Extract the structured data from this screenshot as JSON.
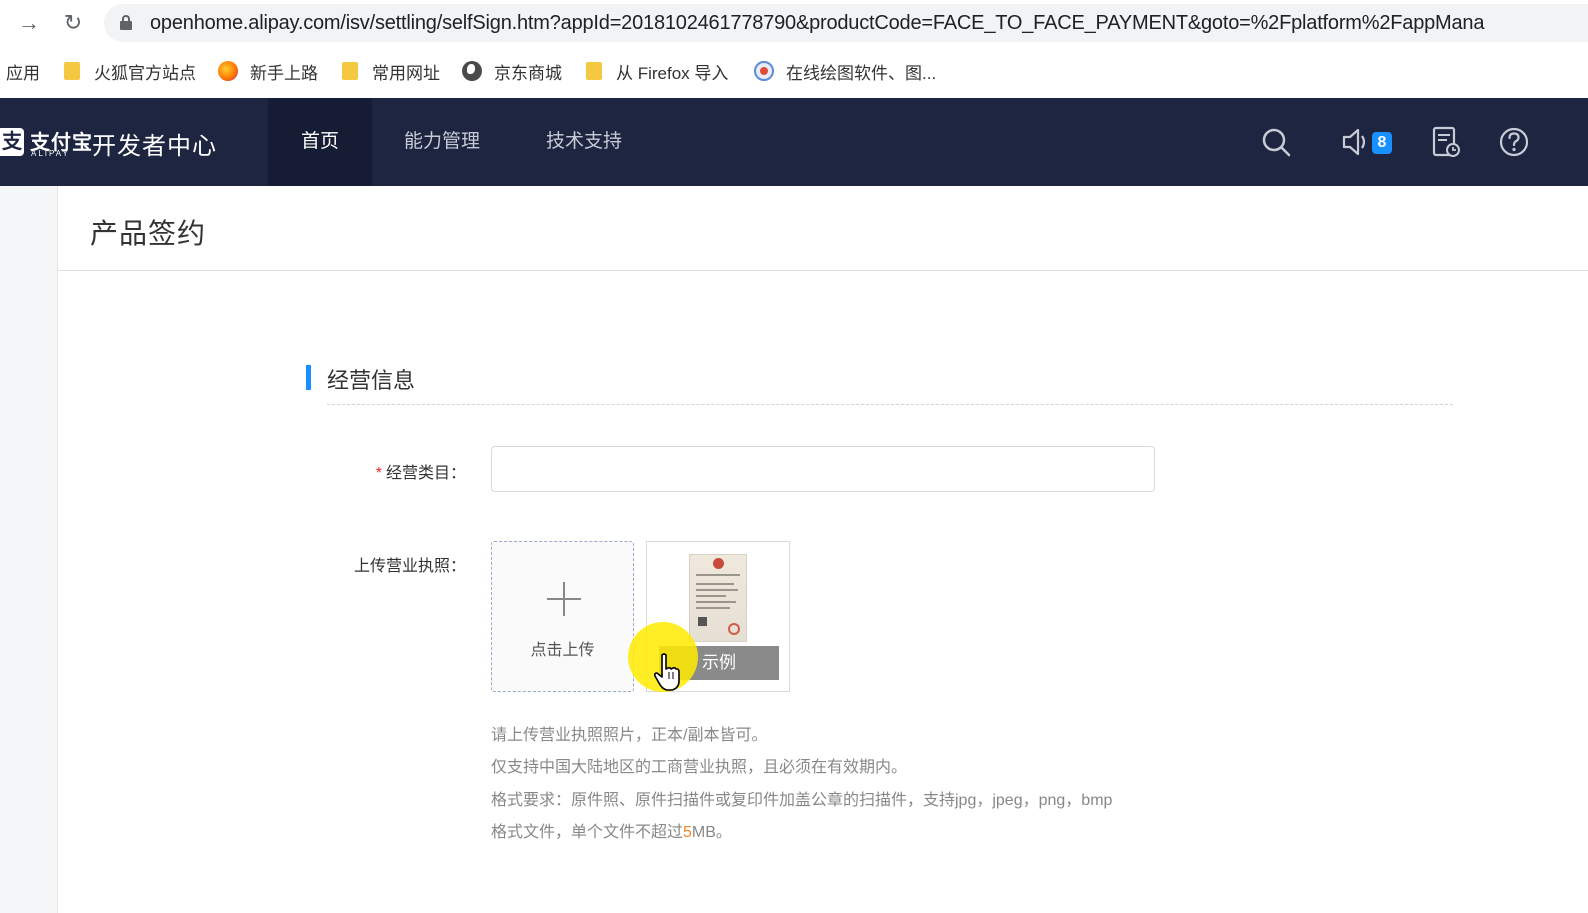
{
  "browser": {
    "back_glyph": "→",
    "reload_glyph": "↻",
    "url": "openhome.alipay.com/isv/settling/selfSign.htm?appId=2018102461778790&productCode=FACE_TO_FACE_PAYMENT&goto=%2Fplatform%2FappMana"
  },
  "bookmarks": {
    "apps_label": "应用",
    "items": [
      {
        "label": "火狐官方站点",
        "icon": "folder-icon"
      },
      {
        "label": "新手上路",
        "icon": "firefox-icon"
      },
      {
        "label": "常用网址",
        "icon": "folder-icon"
      },
      {
        "label": "京东商城",
        "icon": "globe-icon"
      },
      {
        "label": "从 Firefox 导入",
        "icon": "folder-icon"
      },
      {
        "label": "在线绘图软件、图...",
        "icon": "drawing-app-icon"
      }
    ]
  },
  "header": {
    "logo_mark": "支",
    "logo_cn": "支付宝",
    "logo_en": "ALIPAY",
    "title": "开发者中心",
    "tabs": [
      {
        "label": "首页",
        "active": true
      },
      {
        "label": "能力管理",
        "active": false
      },
      {
        "label": "技术支持",
        "active": false
      }
    ],
    "notification_count": "8",
    "badge_color": "#1890ff"
  },
  "page": {
    "title": "产品签约"
  },
  "section": {
    "title": "经营信息",
    "accent_color": "#1890ff"
  },
  "form": {
    "category": {
      "required_mark": "*",
      "label": "经营类目：",
      "value": ""
    },
    "license": {
      "label": "上传营业执照：",
      "upload_text": "点击上传",
      "sample_label": "示例",
      "help": {
        "line1": "请上传营业执照照片，正本/副本皆可。",
        "line2": "仅支持中国大陆地区的工商营业执照，且必须在有效期内。",
        "line3": "格式要求：原件照、原件扫描件或复印件加盖公章的扫描件，支持jpg，jpeg，png，bmp",
        "line4_pre": "格式文件，单个文件不超过",
        "line4_size": "5",
        "line4_post": "MB。"
      }
    }
  }
}
